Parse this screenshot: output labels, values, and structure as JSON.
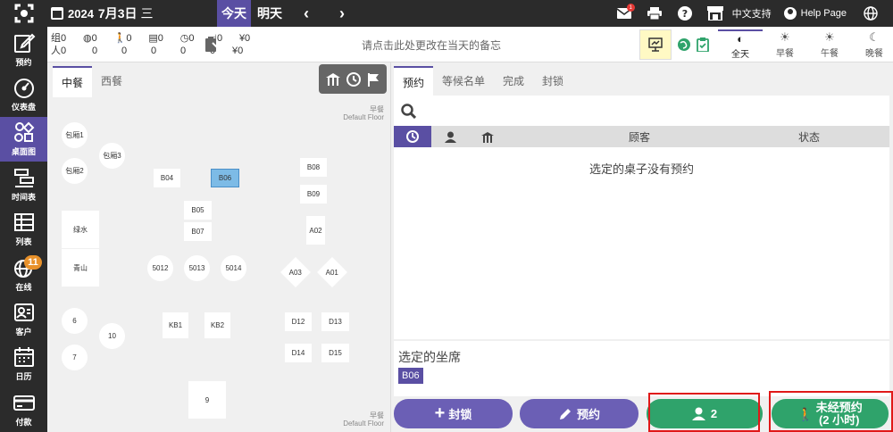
{
  "topbar": {
    "year": "2024",
    "month_day": "7月3日",
    "weekday": "三",
    "today_label": "今天",
    "tomorrow_label": "明天",
    "mail_badge": "1",
    "support_label": "中文支持",
    "help_label": "Help Page"
  },
  "sidebar": {
    "items": [
      {
        "label": "预约"
      },
      {
        "label": "仪表盘"
      },
      {
        "label": "桌面图"
      },
      {
        "label": "时间表"
      },
      {
        "label": "列表"
      },
      {
        "label": "在线",
        "badge": "11"
      },
      {
        "label": "客户"
      },
      {
        "label": "日历"
      },
      {
        "label": "付款"
      }
    ]
  },
  "stats": {
    "row1_label": "组",
    "row2_label": "人",
    "row1": [
      "0",
      "0",
      "0",
      "0",
      "0",
      "0",
      "¥0"
    ],
    "row2": [
      "0",
      "0",
      "0",
      "0",
      "0",
      "0",
      "¥0"
    ]
  },
  "memo_placeholder": "请点击此处更改在当天的备忘",
  "periods": [
    {
      "label": "全天",
      "symbol": "◐"
    },
    {
      "label": "早餐",
      "symbol": "☀"
    },
    {
      "label": "午餐",
      "symbol": "☀"
    },
    {
      "label": "晚餐",
      "symbol": "☾"
    }
  ],
  "floor": {
    "tabs": [
      "中餐",
      "西餐"
    ],
    "top_label_1": "早餐",
    "top_label_2": "Default Floor",
    "bottom_label_1": "早餐",
    "bottom_label_2": "Default Floor",
    "tables": {
      "t_bx1": "包厢1",
      "t_bx2": "包厢2",
      "t_bx3": "包厢3",
      "t_b04": "B04",
      "t_b06": "B06",
      "t_b08": "B08",
      "t_b09": "B09",
      "t_b05": "B05",
      "t_b07": "B07",
      "t_a02": "A02",
      "t_lushui": "绿水",
      "t_qingshan": "青山",
      "t_5012": "5012",
      "t_5013": "5013",
      "t_5014": "5014",
      "t_a03": "A03",
      "t_a01": "A01",
      "t_6": "6",
      "t_10": "10",
      "t_7": "7",
      "t_kb1": "KB1",
      "t_kb2": "KB2",
      "t_d12": "D12",
      "t_d13": "D13",
      "t_d14": "D14",
      "t_d15": "D15",
      "t_9": "9"
    }
  },
  "reservations": {
    "tabs": [
      "预约",
      "等候名单",
      "完成",
      "封锁"
    ],
    "col_guest": "顾客",
    "col_status": "状态",
    "empty_message": "选定的桌子没有预约",
    "selected_label": "选定的坐席",
    "selected_table": "B06"
  },
  "actions": {
    "block_label": "封锁",
    "reserve_label": "预约",
    "party_size": "2",
    "walkin_label": "未经预约",
    "walkin_duration": "(2 小时)"
  },
  "colors": {
    "accent": "#5a4fa3",
    "green": "#2fa36b",
    "dark": "#2b2b2b",
    "selected_table": "#7dbbe6",
    "highlight_border": "#e01818"
  }
}
